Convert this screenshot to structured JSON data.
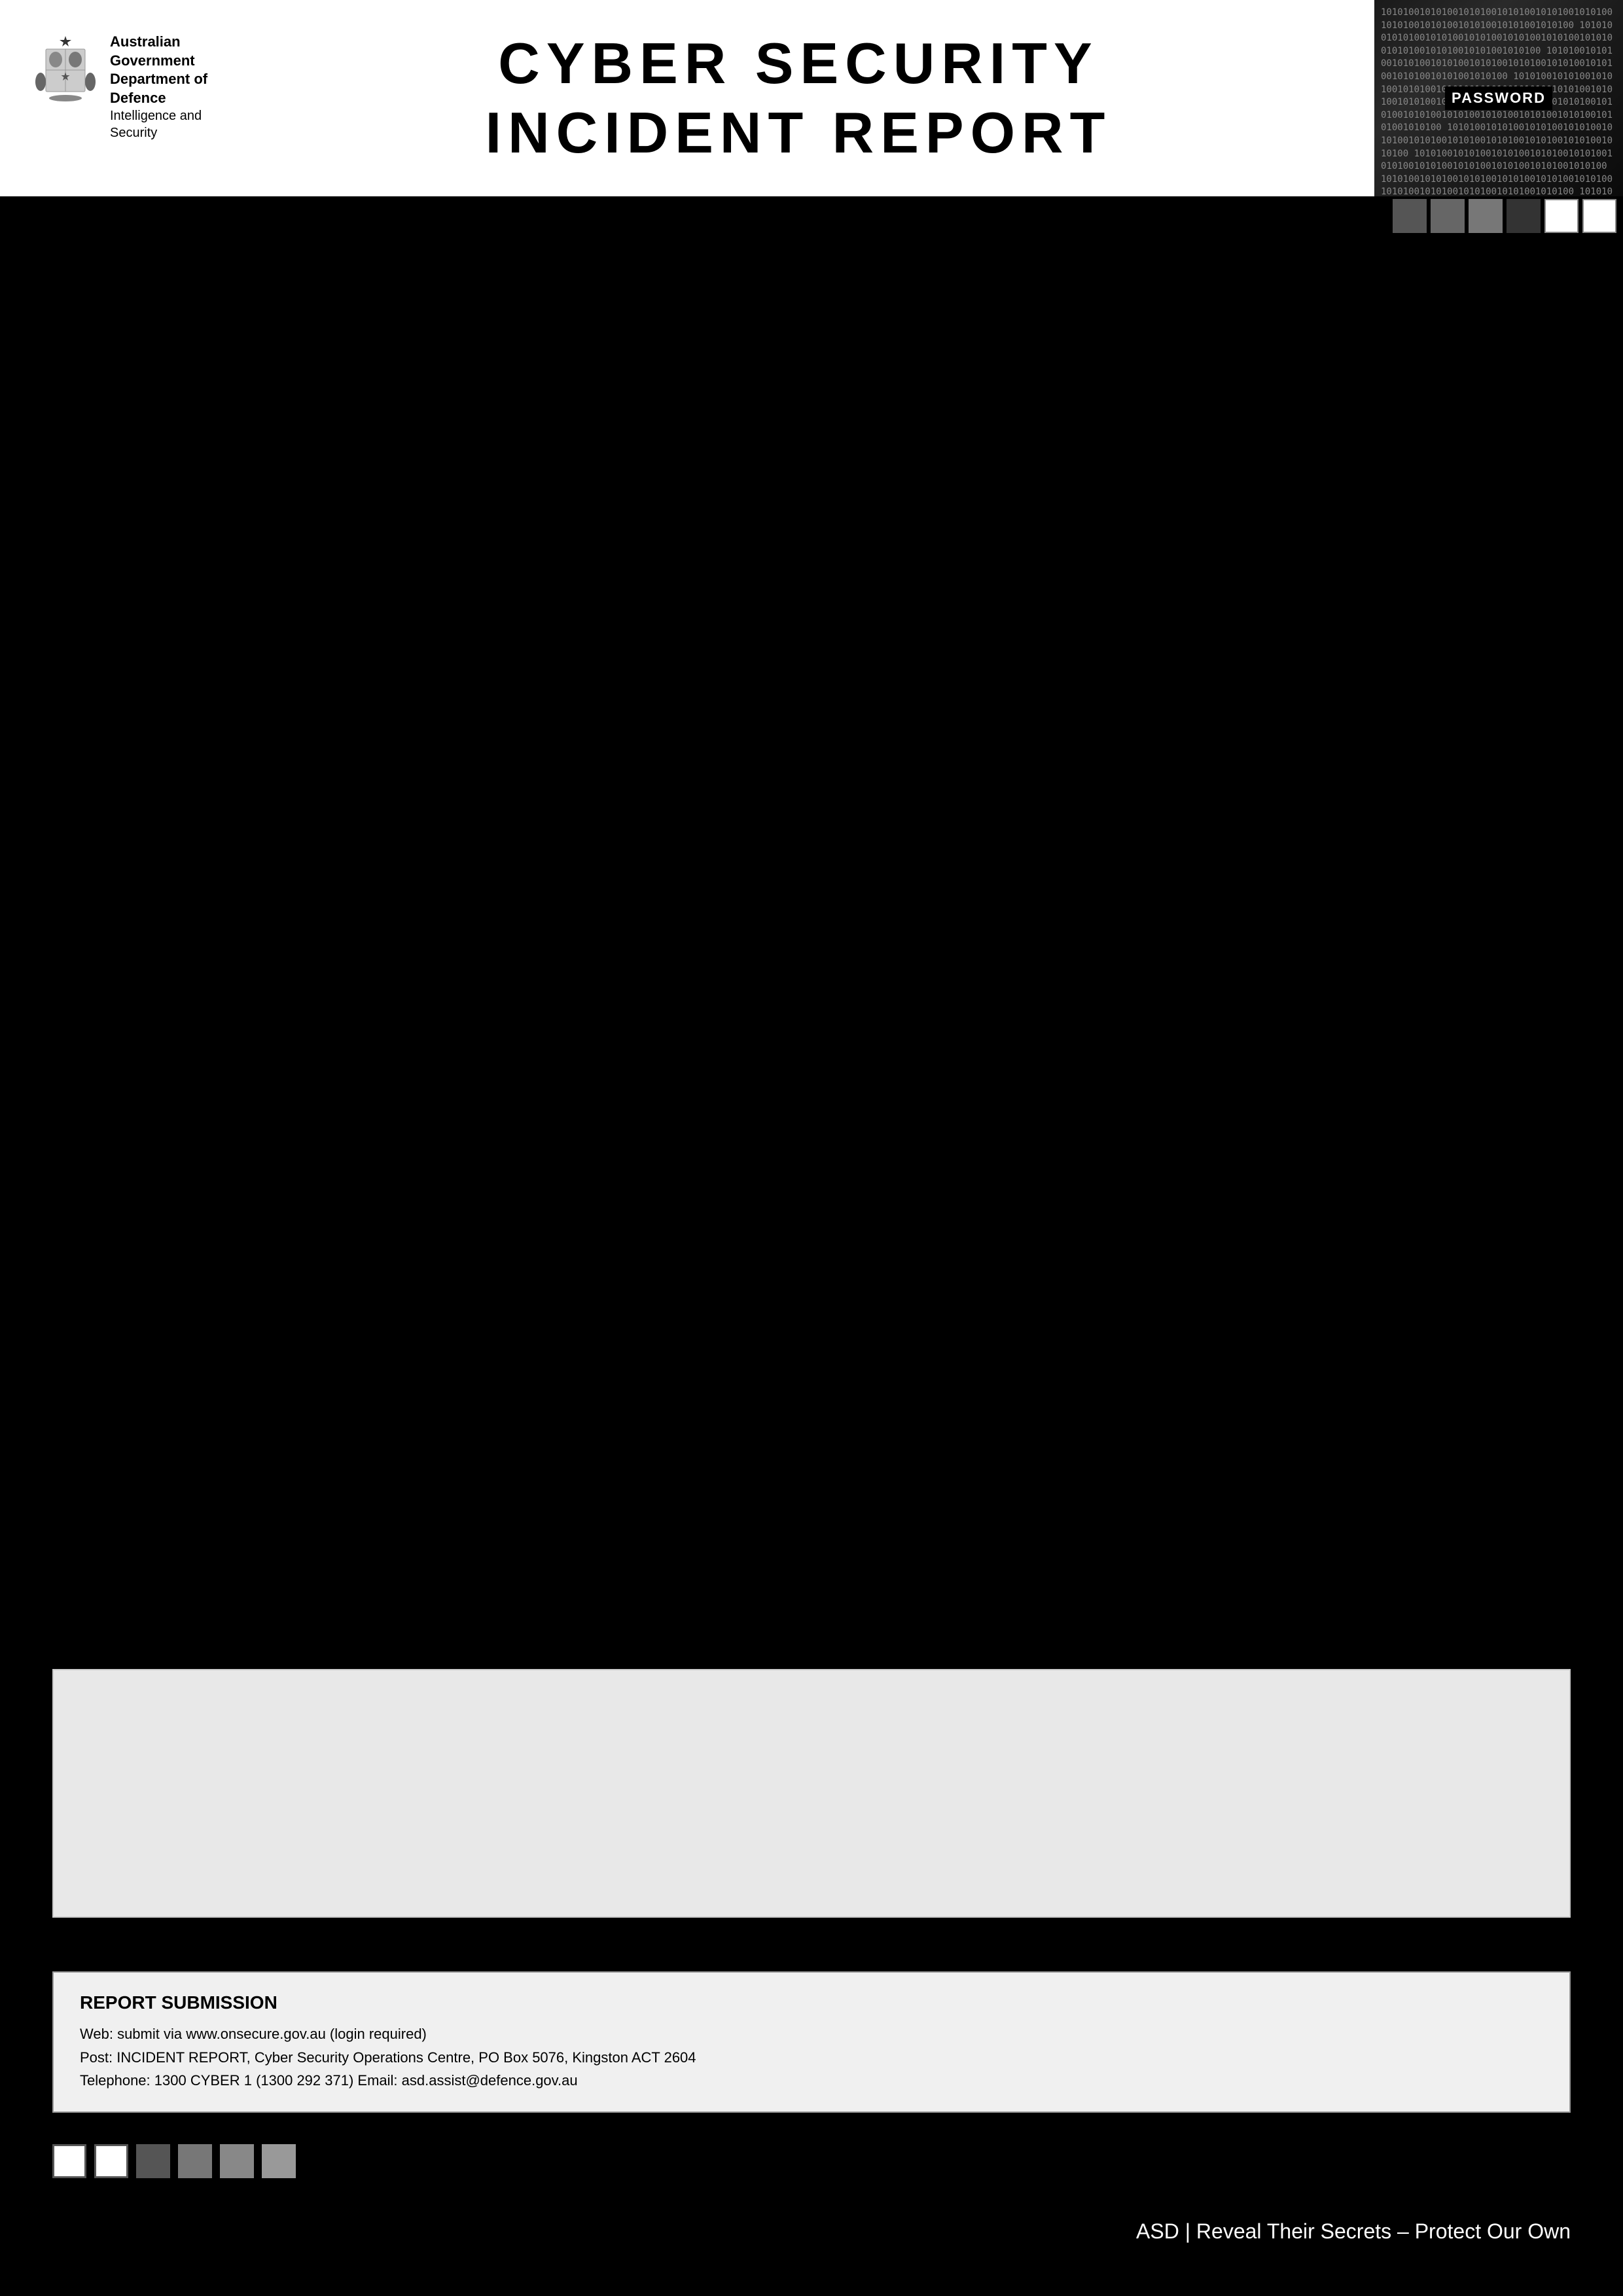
{
  "header": {
    "logo_alt": "Australian Government Coat of Arms",
    "gov_line1": "Australian Government",
    "gov_line2": "Department of Defence",
    "gov_line3": "Intelligence and Security",
    "title_line1": "CYBER SECURITY",
    "title_line2": "INCIDENT REPORT"
  },
  "binary_image": {
    "password_label": "PASSWORD",
    "binary_text": "10101001010100101010010101001010100101010010101001010100101010010101001010100101010010101001010100101010010101001010100101010010101001010100101010010101001010100101010010101001010100101010010101001010100101010010101001010100101010010101001010100101010010101001010100101010010101001010100"
  },
  "color_squares_top": [
    {
      "color": "#595959",
      "label": "dark-grey-1"
    },
    {
      "color": "#6e6e6e",
      "label": "dark-grey-2"
    },
    {
      "color": "#7a7a7a",
      "label": "dark-grey-3"
    },
    {
      "color": "#3a3a3a",
      "label": "dark-grey-4"
    },
    {
      "color": "#ffffff",
      "label": "white-1"
    },
    {
      "color": "#ffffff",
      "label": "white-2"
    }
  ],
  "color_squares_bottom": [
    {
      "color": "outline",
      "label": "white-outline-1"
    },
    {
      "color": "outline",
      "label": "white-outline-2"
    },
    {
      "color": "#555555",
      "label": "filled-1"
    },
    {
      "color": "#6a6a6a",
      "label": "filled-2"
    },
    {
      "color": "#888888",
      "label": "filled-3"
    },
    {
      "color": "#999999",
      "label": "filled-4"
    }
  ],
  "report_submission": {
    "title": "REPORT SUBMISSION",
    "line1": "Web: submit via www.onsecure.gov.au (login required)",
    "line2": "Post: INCIDENT REPORT, Cyber Security Operations Centre, PO Box 5076, Kingston ACT 2604",
    "line3": "Telephone: 1300 CYBER 1 (1300 292 371)  Email: asd.assist@defence.gov.au"
  },
  "footer": {
    "tagline": "ASD | Reveal Their Secrets – Protect Our Own"
  }
}
